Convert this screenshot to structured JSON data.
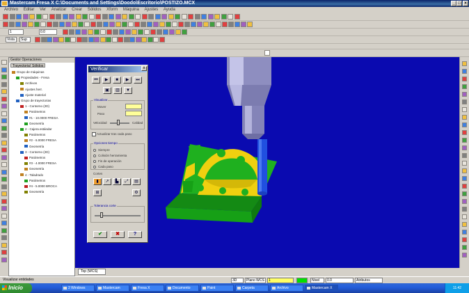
{
  "window": {
    "title": "Mastercam Fresa X   C:\\Documents and Settings\\Doodo\\Escritorio\\POSTIZO.MCX"
  },
  "menu": [
    "Archivo",
    "Editar",
    "Ver",
    "Analizar",
    "Crear",
    "Sólidos",
    "Xform",
    "Máquina",
    "Ajustes",
    "Ayuda"
  ],
  "toolbars": {
    "level_value": "1",
    "z_value": "0.0",
    "view_field": "Vista",
    "planes_field": "Sup"
  },
  "ops_manager": {
    "header": "Gestor Operaciones",
    "tabs": [
      "Trayectorias",
      "Sólidos"
    ],
    "tree": [
      {
        "label": "Grupo de máquinas",
        "indent": 0
      },
      {
        "label": "Propiedades - Fresa",
        "indent": 1
      },
      {
        "label": "Archivos",
        "indent": 2
      },
      {
        "label": "Ajustes herr.",
        "indent": 2
      },
      {
        "label": "Ajuste material",
        "indent": 2
      },
      {
        "label": "Grupo de trayectorias",
        "indent": 1
      },
      {
        "label": "1 - Contorno (2D)",
        "indent": 2
      },
      {
        "label": "Parámetros",
        "indent": 3
      },
      {
        "label": "#1 - 10.0000 FRESA",
        "indent": 3
      },
      {
        "label": "Geometría",
        "indent": 3
      },
      {
        "label": "2 - Cajera estándar",
        "indent": 2
      },
      {
        "label": "Parámetros",
        "indent": 3
      },
      {
        "label": "#2 - 6.0000 FRESA",
        "indent": 3
      },
      {
        "label": "Geometría",
        "indent": 3
      },
      {
        "label": "3 - Contorno (2D)",
        "indent": 2
      },
      {
        "label": "Parámetros",
        "indent": 3
      },
      {
        "label": "#3 - 4.0000 FRESA",
        "indent": 3
      },
      {
        "label": "Geometría",
        "indent": 3
      },
      {
        "label": "4 - Taladrado",
        "indent": 2
      },
      {
        "label": "Parámetros",
        "indent": 3
      },
      {
        "label": "#4 - 5.0000 BROCA",
        "indent": 3
      },
      {
        "label": "Geometría",
        "indent": 3
      }
    ]
  },
  "verify": {
    "title": "Verificar",
    "close": "x",
    "play": [
      "⏮",
      "▶",
      "■",
      "▶",
      "⏭"
    ],
    "display_group": "Visualizar",
    "move_label": "Mover",
    "step_label": "Paso",
    "speed_label": "Velocidad",
    "quality_label": "Calidad",
    "check_label": "Actualizar tras cada paso",
    "options_group": "Opciones tiempo",
    "radios": [
      "Siempre",
      "Colisión herramienta",
      "Fin de operación",
      "Cada paso"
    ],
    "misc_label": "Cortes",
    "tolerance_group": "Tolerancia corte",
    "ok": "✔",
    "cancel": "✖",
    "help": "?"
  },
  "viewport": {
    "tab_label": "Top (WCS)",
    "colors": {
      "bg": "#0a0ab0",
      "stock": "#1fb01f",
      "cut": "#f0d010",
      "tool": "#2050e0",
      "holder": "#9898c8"
    }
  },
  "statusbar": {
    "text": "Visualizar entidades",
    "fields": [
      "3D",
      "Plano WCS",
      "1",
      "Nivel",
      "0.0",
      "Atributos"
    ]
  },
  "taskbar": {
    "start": "Inicio",
    "items": [
      "2 Windows",
      "Mastercam",
      "Fresa X",
      "Documento",
      "Paint",
      "Carpeta",
      "Archivo",
      "Mastercam X"
    ],
    "clock": "11:42"
  }
}
